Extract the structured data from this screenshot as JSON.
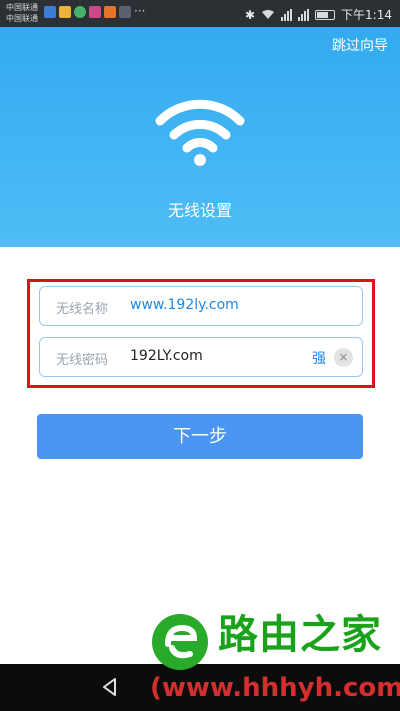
{
  "status_bar": {
    "carrier_1": "中国联通",
    "carrier_2": "中国联通",
    "time": "下午1:14"
  },
  "header": {
    "skip_label": "跳过向导",
    "title": "无线设置",
    "icon": "wifi-icon"
  },
  "form": {
    "ssid_label": "无线名称",
    "ssid_value": "www.192ly.com",
    "password_label": "无线密码",
    "password_value": "192LY.com",
    "password_strength": "强",
    "clear_symbol": "×"
  },
  "next_button_label": "下一步",
  "watermark": {
    "brand_text": "路由之家",
    "url_text": "(www.hhhyh.com)"
  },
  "colors": {
    "header_top": "#33aaf0",
    "header_bottom": "#4fbdf6",
    "primary_button": "#4a95f2",
    "highlight_border": "#e1111b",
    "link_blue": "#1e88e5"
  }
}
